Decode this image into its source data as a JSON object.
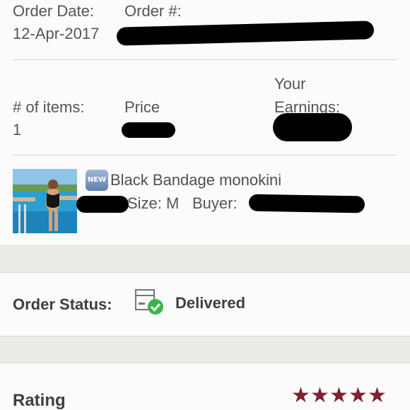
{
  "order": {
    "date_label": "Order Date:",
    "date_value": "12-Apr-2017",
    "number_label": "Order #:"
  },
  "summary": {
    "items_label": "# of items:",
    "items_value": "1",
    "price_label": "Price",
    "earnings_label_line1": "Your",
    "earnings_label_line2": "Earnings:"
  },
  "product": {
    "badge": "NEW",
    "title": "Black Bandage monokini",
    "size_text": "Size: M",
    "buyer_label": "Buyer:"
  },
  "status": {
    "label": "Order Status:",
    "value": "Delivered",
    "icon": "package-delivered-icon",
    "check_color": "#3bb54a"
  },
  "rating": {
    "label": "Rating",
    "stars": 5,
    "star_glyph": "★",
    "star_color": "#7b2333"
  }
}
